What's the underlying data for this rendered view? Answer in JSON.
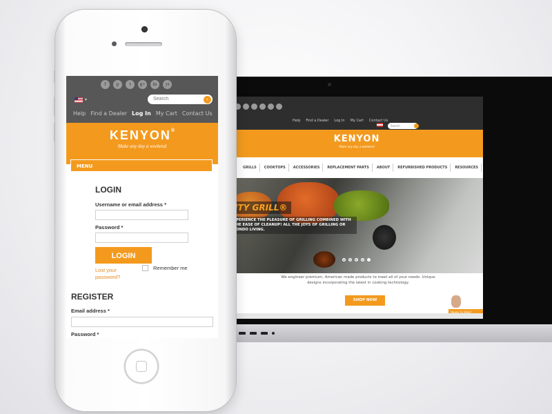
{
  "phone": {
    "social_icons": [
      "f",
      "p",
      "t",
      "g+",
      "in",
      "yt"
    ],
    "social_icon_names": [
      "facebook-icon",
      "pinterest-icon",
      "twitter-icon",
      "googleplus-icon",
      "linkedin-icon",
      "youtube-icon"
    ],
    "search_placeholder": "Search",
    "nav": [
      "Help",
      "Find a Dealer",
      "Log In",
      "My Cart",
      "Contact Us"
    ],
    "active_nav": "Log In",
    "brand": "KENYON",
    "brand_mark": "®",
    "tagline": "Make any day a weekend",
    "menu_label": "MENU",
    "login": {
      "heading": "LOGIN",
      "username_label": "Username or email address",
      "password_label": "Password",
      "required_mark": "*",
      "button": "LOGIN",
      "lost_password": "Lost your password?",
      "remember_me": "Remember me"
    },
    "register": {
      "heading": "REGISTER",
      "email_label": "Email address",
      "password_label": "Password",
      "required_mark": "*"
    }
  },
  "laptop": {
    "nav": [
      "Help",
      "Find a Dealer",
      "Log In",
      "My Cart",
      "Contact Us"
    ],
    "search_placeholder": "Search",
    "brand": "KENYON",
    "tagline": "Make any day a weekend",
    "menu": [
      "GRILLS",
      "COOKTOPS",
      "ACCESSORIES",
      "REPLACEMENT PARTS",
      "ABOUT",
      "REFURBISHED PRODUCTS",
      "RESOURCES"
    ],
    "hero_title": "ITY GRILL®",
    "hero_text": "XPERIENCE THE PLEASURE OF GRILLING COMBINED WITH THE EASE OF CLEANUP! ALL THE JOYS OF GRILLING OR CONDO LIVING.",
    "slides_total": 5,
    "slide_active": 5,
    "description": "We engineer premium, American made products to meet all of your needs. Unique designs incorporating the latest in cooking technology.",
    "shop_button": "SHOP NOW",
    "help_widget": "Happy to Help!"
  },
  "colors": {
    "accent": "#f39a1e",
    "topbar_phone": "#575757",
    "topbar_laptop": "#2e2e2e"
  }
}
